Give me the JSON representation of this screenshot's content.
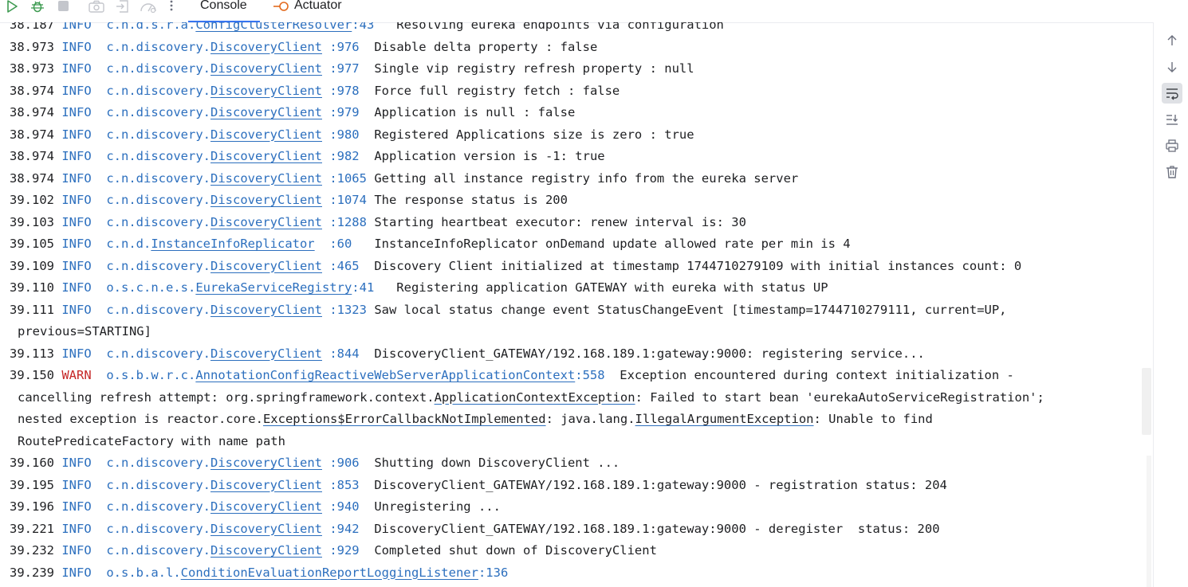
{
  "toolbar": {
    "icons": [
      "run-icon",
      "debug-icon",
      "stop-icon",
      "camera-icon",
      "restore-icon",
      "dashboard-icon",
      "more-icon"
    ],
    "tabs": [
      {
        "label": "Console",
        "active": true
      },
      {
        "label": "Actuator",
        "active": false
      }
    ]
  },
  "console": {
    "lines": [
      {
        "t": "38.187",
        "lvl": "INFO",
        "pre": "c.n.d.s.r.a.",
        "cls": "ConfigClusterResolver",
        "ln": ":43",
        "msg": "   Resolving eureka endpoints via configuration"
      },
      {
        "t": "38.973",
        "lvl": "INFO",
        "pre": "c.n.discovery.",
        "cls": "DiscoveryClient",
        "ln": " :976",
        "msg": "  Disable delta property : false"
      },
      {
        "t": "38.973",
        "lvl": "INFO",
        "pre": "c.n.discovery.",
        "cls": "DiscoveryClient",
        "ln": " :977",
        "msg": "  Single vip registry refresh property : null"
      },
      {
        "t": "38.974",
        "lvl": "INFO",
        "pre": "c.n.discovery.",
        "cls": "DiscoveryClient",
        "ln": " :978",
        "msg": "  Force full registry fetch : false"
      },
      {
        "t": "38.974",
        "lvl": "INFO",
        "pre": "c.n.discovery.",
        "cls": "DiscoveryClient",
        "ln": " :979",
        "msg": "  Application is null : false"
      },
      {
        "t": "38.974",
        "lvl": "INFO",
        "pre": "c.n.discovery.",
        "cls": "DiscoveryClient",
        "ln": " :980",
        "msg": "  Registered Applications size is zero : true"
      },
      {
        "t": "38.974",
        "lvl": "INFO",
        "pre": "c.n.discovery.",
        "cls": "DiscoveryClient",
        "ln": " :982",
        "msg": "  Application version is -1: true"
      },
      {
        "t": "38.974",
        "lvl": "INFO",
        "pre": "c.n.discovery.",
        "cls": "DiscoveryClient",
        "ln": " :1065",
        "msg": " Getting all instance registry info from the eureka server"
      },
      {
        "t": "39.102",
        "lvl": "INFO",
        "pre": "c.n.discovery.",
        "cls": "DiscoveryClient",
        "ln": " :1074",
        "msg": " The response status is 200"
      },
      {
        "t": "39.103",
        "lvl": "INFO",
        "pre": "c.n.discovery.",
        "cls": "DiscoveryClient",
        "ln": " :1288",
        "msg": " Starting heartbeat executor: renew interval is: 30"
      },
      {
        "t": "39.105",
        "lvl": "INFO",
        "pre": "c.n.d.",
        "cls": "InstanceInfoReplicator",
        "ln": "  :60",
        "msg": "   InstanceInfoReplicator onDemand update allowed rate per min is 4"
      },
      {
        "t": "39.109",
        "lvl": "INFO",
        "pre": "c.n.discovery.",
        "cls": "DiscoveryClient",
        "ln": " :465",
        "msg": "  Discovery Client initialized at timestamp 1744710279109 with initial instances count: 0"
      },
      {
        "t": "39.110",
        "lvl": "INFO",
        "pre": "o.s.c.n.e.s.",
        "cls": "EurekaServiceRegistry",
        "ln": ":41",
        "msg": "   Registering application GATEWAY with eureka with status UP"
      },
      {
        "t": "39.111",
        "lvl": "INFO",
        "pre": "c.n.discovery.",
        "cls": "DiscoveryClient",
        "ln": " :1323",
        "msg": " Saw local status change event StatusChangeEvent [timestamp=1744710279111, current=UP,"
      },
      {
        "cont": "previous=STARTING]"
      },
      {
        "t": "39.113",
        "lvl": "INFO",
        "pre": "c.n.discovery.",
        "cls": "DiscoveryClient",
        "ln": " :844",
        "msg": "  DiscoveryClient_GATEWAY/192.168.189.1:gateway:9000: registering service..."
      },
      {
        "t": "39.150",
        "lvl": "WARN",
        "pre": "o.s.b.w.r.c.",
        "cls": "AnnotationConfigReactiveWebServerApplicationContext",
        "ln": ":558",
        "msg": "  Exception encountered during context initialization -"
      },
      {
        "cont": "cancelling refresh attempt: org.springframework.context.",
        "cont_cls": "ApplicationContextException",
        "cont_rest": ": Failed to start bean 'eurekaAutoServiceRegistration';"
      },
      {
        "cont": "nested exception is reactor.core.",
        "cont_cls": "Exceptions$ErrorCallbackNotImplemented",
        "cont_rest": ": java.lang.",
        "cont_cls2": "IllegalArgumentException",
        "cont_rest2": ": Unable to find"
      },
      {
        "cont": "RoutePredicateFactory with name path"
      },
      {
        "t": "39.160",
        "lvl": "INFO",
        "pre": "c.n.discovery.",
        "cls": "DiscoveryClient",
        "ln": " :906",
        "msg": "  Shutting down DiscoveryClient ..."
      },
      {
        "t": "39.195",
        "lvl": "INFO",
        "pre": "c.n.discovery.",
        "cls": "DiscoveryClient",
        "ln": " :853",
        "msg": "  DiscoveryClient_GATEWAY/192.168.189.1:gateway:9000 - registration status: 204"
      },
      {
        "t": "39.196",
        "lvl": "INFO",
        "pre": "c.n.discovery.",
        "cls": "DiscoveryClient",
        "ln": " :940",
        "msg": "  Unregistering ..."
      },
      {
        "t": "39.221",
        "lvl": "INFO",
        "pre": "c.n.discovery.",
        "cls": "DiscoveryClient",
        "ln": " :942",
        "msg": "  DiscoveryClient_GATEWAY/192.168.189.1:gateway:9000 - deregister  status: 200"
      },
      {
        "t": "39.232",
        "lvl": "INFO",
        "pre": "c.n.discovery.",
        "cls": "DiscoveryClient",
        "ln": " :929",
        "msg": "  Completed shut down of DiscoveryClient"
      },
      {
        "t": "39.239",
        "lvl": "INFO",
        "pre": "o.s.b.a.l.",
        "cls": "ConditionEvaluationReportLoggingListener",
        "ln": ":136",
        "msg": ""
      }
    ]
  },
  "right_strip": {
    "icons": [
      "scroll-up-icon",
      "scroll-down-icon",
      "soft-wrap-icon",
      "scroll-to-end-icon",
      "print-icon",
      "clear-all-icon"
    ],
    "active": "soft-wrap-icon"
  },
  "colors": {
    "info": "#2c6fbe",
    "warn": "#c62828",
    "text": "#1e1f22",
    "run": "#3d9a50"
  }
}
